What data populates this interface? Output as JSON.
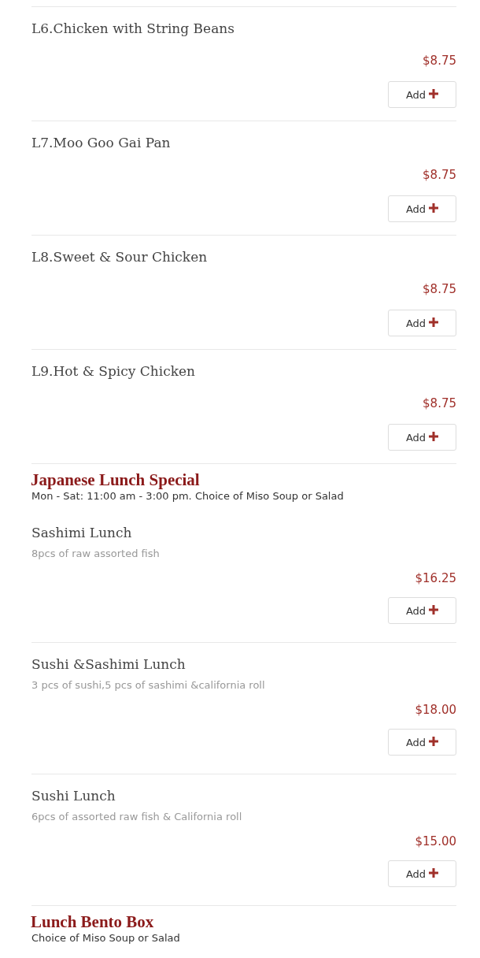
{
  "sections": [
    {
      "items": [
        {
          "name": "L6.Chicken with String Beans",
          "price": "$8.75",
          "button": "Add"
        },
        {
          "name": "L7.Moo Goo Gai Pan",
          "price": "$8.75",
          "button": "Add"
        },
        {
          "name": "L8.Sweet & Sour Chicken",
          "price": "$8.75",
          "button": "Add"
        },
        {
          "name": "L9.Hot & Spicy Chicken",
          "price": "$8.75",
          "button": "Add"
        }
      ]
    },
    {
      "title": "Japanese Lunch Special",
      "subtitle": "Mon - Sat: 11:00 am - 3:00 pm. Choice of Miso Soup or Salad",
      "items": [
        {
          "name": "Sashimi Lunch",
          "description": "8pcs of raw assorted fish",
          "price": "$16.25",
          "button": "Add"
        },
        {
          "name": "Sushi &Sashimi Lunch",
          "description": "3 pcs of sushi,5 pcs of sashimi &california roll",
          "price": "$18.00",
          "button": "Add"
        },
        {
          "name": "Sushi Lunch",
          "description": "6pcs of assorted raw fish & California roll",
          "price": "$15.00",
          "button": "Add"
        }
      ]
    },
    {
      "title": "Lunch Bento Box",
      "subtitle": "Choice of Miso Soup or Salad"
    }
  ]
}
